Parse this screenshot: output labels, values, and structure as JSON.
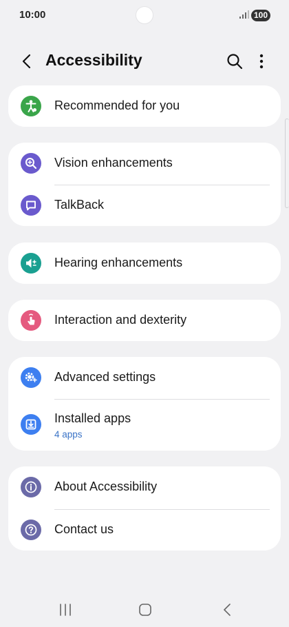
{
  "status": {
    "time": "10:00",
    "battery": "100"
  },
  "header": {
    "title": "Accessibility"
  },
  "sections": {
    "recommended": {
      "label": "Recommended for you"
    },
    "vision": {
      "label": "Vision enhancements"
    },
    "talkback": {
      "label": "TalkBack"
    },
    "hearing": {
      "label": "Hearing enhancements"
    },
    "interaction": {
      "label": "Interaction and dexterity"
    },
    "advanced": {
      "label": "Advanced settings"
    },
    "installed": {
      "label": "Installed apps",
      "sub": "4 apps"
    },
    "about": {
      "label": "About Accessibility"
    },
    "contact": {
      "label": "Contact us"
    }
  },
  "colors": {
    "green": "#3aa54a",
    "purple": "#6a5acd",
    "teal": "#1aa091",
    "pink": "#e55a7f",
    "blue": "#3d7ff0",
    "slate": "#6b6aa8",
    "link": "#3b74c7"
  },
  "icons": {
    "recommended": "accessibility-person-icon",
    "vision": "magnifier-plus-icon",
    "talkback": "speech-bubble-icon",
    "hearing": "speaker-plus-icon",
    "interaction": "hand-tap-icon",
    "advanced": "gear-plus-icon",
    "installed": "download-icon",
    "about": "info-icon",
    "contact": "question-icon"
  }
}
